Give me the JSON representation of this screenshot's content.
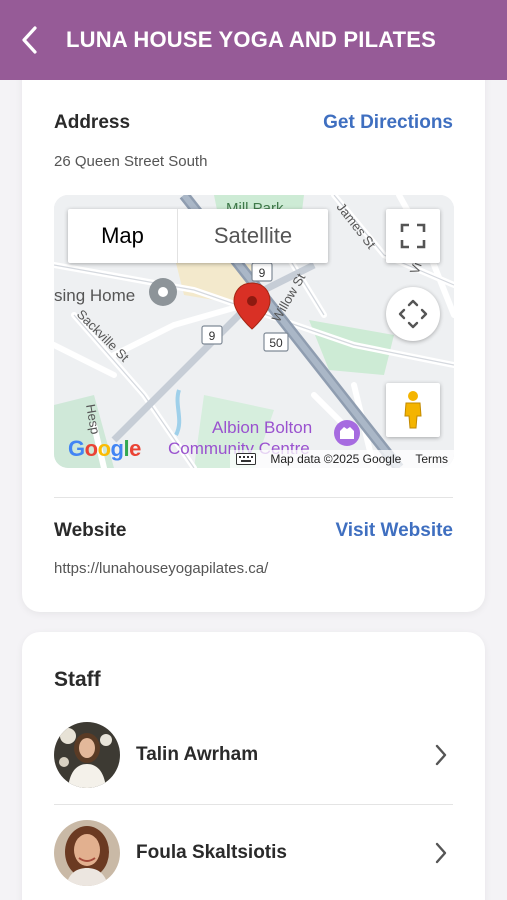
{
  "header": {
    "title": "LUNA HOUSE YOGA AND PILATES"
  },
  "address": {
    "label": "Address",
    "link": "Get Directions",
    "value": "26 Queen Street South"
  },
  "map": {
    "tab_map": "Map",
    "tab_satellite": "Satellite",
    "labels": {
      "mill_park": "Mill Park",
      "james_st": "James St",
      "victoria": "Victoria",
      "sing_home": "sing Home",
      "sackville_st": "Sackville St",
      "willow_st": "Willow St",
      "albion_1": "Albion Bolton",
      "albion_2": "Community Centre",
      "hesp": "Hesp",
      "route_9a": "9",
      "route_9b": "9",
      "route_50": "50"
    },
    "credit": "Map data ©2025 Google",
    "terms": "Terms",
    "google": [
      "G",
      "o",
      "o",
      "g",
      "l",
      "e"
    ]
  },
  "website": {
    "label": "Website",
    "link": "Visit Website",
    "value": "https://lunahouseyogapilates.ca/"
  },
  "staff": {
    "title": "Staff",
    "members": [
      {
        "name": "Talin Awrham"
      },
      {
        "name": "Foula Skaltsiotis"
      }
    ]
  },
  "colors": {
    "header": "#965b97",
    "link": "#3f6fc0",
    "pin": "#d93025"
  }
}
